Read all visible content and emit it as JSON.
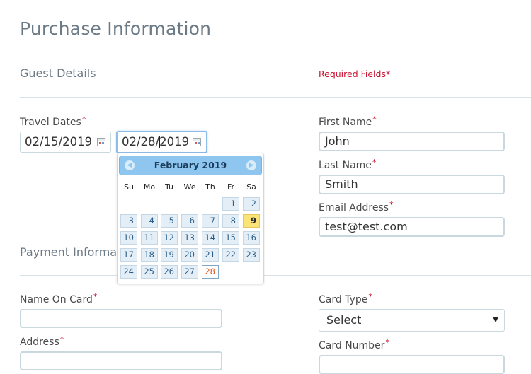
{
  "page": {
    "title": "Purchase Information",
    "required_note": "Required Fields*"
  },
  "guest": {
    "section_title": "Guest Details",
    "travel_dates_label": "Travel Dates",
    "start_date": "02/15/2019",
    "end_date": "02/28/2019",
    "first_name_label": "First Name",
    "first_name": "John",
    "last_name_label": "Last Name",
    "last_name": "Smith",
    "email_label": "Email Address",
    "email": "test@test.com"
  },
  "payment": {
    "section_title": "Payment Informa",
    "name_on_card_label": "Name On Card",
    "address_label": "Address",
    "card_type_label": "Card Type",
    "card_type_value": "Select",
    "card_number_label": "Card Number"
  },
  "datepicker": {
    "month_title": "February 2019",
    "weekdays": [
      "Su",
      "Mo",
      "Tu",
      "We",
      "Th",
      "Fr",
      "Sa"
    ],
    "weeks": [
      [
        "",
        "",
        "",
        "",
        "",
        "1",
        "2"
      ],
      [
        "3",
        "4",
        "5",
        "6",
        "7",
        "8",
        "9"
      ],
      [
        "10",
        "11",
        "12",
        "13",
        "14",
        "15",
        "16"
      ],
      [
        "17",
        "18",
        "19",
        "20",
        "21",
        "22",
        "23"
      ],
      [
        "24",
        "25",
        "26",
        "27",
        "28",
        "",
        ""
      ]
    ],
    "highlighted_day": "9",
    "selected_day": "28",
    "prev_icon": "chevron-left-icon",
    "next_icon": "chevron-right-icon"
  },
  "colors": {
    "accent_red": "#c8102e",
    "header_blue": "#8fc6f0",
    "highlight_yellow": "#fbe477"
  }
}
